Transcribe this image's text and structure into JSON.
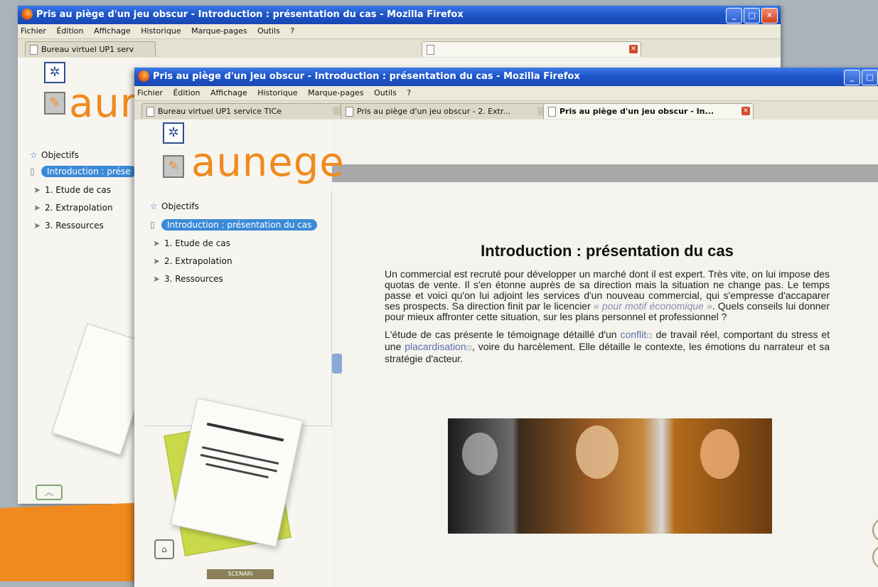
{
  "window_title": "Pris au piège d'un jeu obscur - Introduction : présentation du cas - Mozilla Firefox",
  "menu": [
    "Fichier",
    "Édition",
    "Affichage",
    "Historique",
    "Marque-pages",
    "Outils",
    "?"
  ],
  "back_window": {
    "tab1": "Bureau virtuel UP1 serv",
    "nav": [
      "Objectifs",
      "Introduction : prése",
      "1. Etude de cas",
      "2. Extrapolation",
      "3. Ressources"
    ],
    "logo": "aur"
  },
  "tabs": [
    {
      "label": "Bureau virtuel UP1 service TICe",
      "active": false
    },
    {
      "label": "Pris au piège d'un jeu obscur - 2. Extr...",
      "active": false
    },
    {
      "label": "Pris au piège d'un jeu obscur - In...",
      "active": true
    }
  ],
  "logo": "aunege",
  "nav": [
    {
      "label": "Objectifs",
      "icon": "star-icon"
    },
    {
      "label": "Introduction : présentation du cas",
      "icon": "document-icon",
      "selected": true
    },
    {
      "label": "1. Etude de cas",
      "icon": "chevron-right-icon"
    },
    {
      "label": "2. Extrapolation",
      "icon": "chevron-right-icon"
    },
    {
      "label": "3. Ressources",
      "icon": "chevron-right-icon"
    }
  ],
  "page": {
    "heading": "Introduction : présentation du cas",
    "p1_start": "Un commercial est recruté pour développer un marché dont il est expert. Très vite, on lui impose des quotas de vente. Il s'en étonne auprès de sa direction mais la situation ne change pas. Le temps passe et voici qu'on lui adjoint les services d'un nouveau commercial, qui s'empresse d'accaparer ses prospects. Sa direction finit par le licencier ",
    "p1_quote": "« pour motif économique »",
    "p1_end": ". Quels conseils lui donner pour mieux affronter cette situation, sur les plans personnel et professionnel ?",
    "p2_a": "L'étude de cas présente le témoignage détaillé d'un ",
    "p2_link1": "conflit",
    "p2_b": " de travail réel, comportant du stress et une ",
    "p2_link2": "placardisation",
    "p2_c": ", voire du harcèlement. Elle détaille le contexte, les émotions du narrateur et sa stratégie d'acteur."
  },
  "footer_badge": "SCENARI",
  "colors": {
    "accent_orange": "#f08a1e",
    "titlebar_blue": "#1f56c8",
    "selection_blue": "#3b8ad6",
    "link_blue": "#5a6fb0"
  }
}
